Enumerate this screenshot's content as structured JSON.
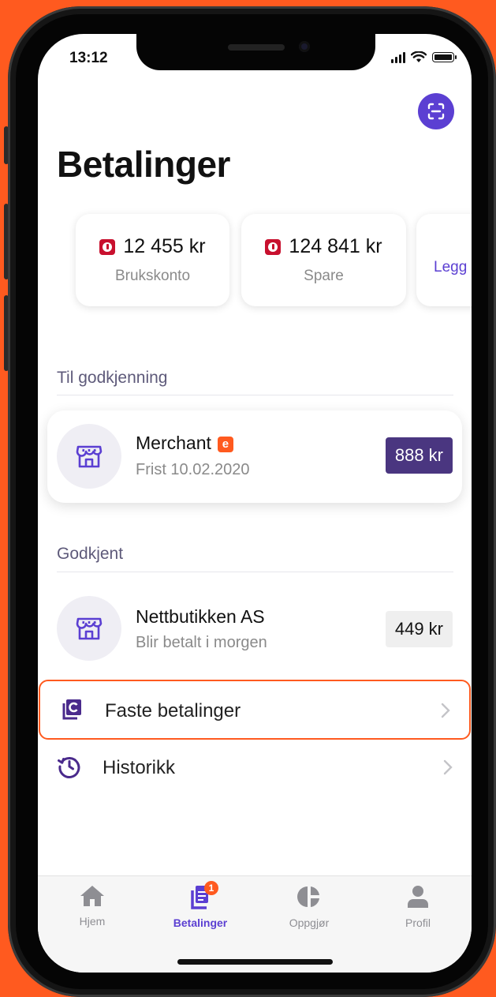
{
  "status_bar": {
    "time": "13:12"
  },
  "header": {
    "title": "Betalinger",
    "scan_icon": "qr-scan-icon"
  },
  "accounts": [
    {
      "amount": "12 455 kr",
      "label": "Brukskonto",
      "icon": "bank-badge-icon"
    },
    {
      "amount": "124 841 kr",
      "label": "Spare",
      "icon": "bank-badge-icon"
    },
    {
      "label": "Legg"
    }
  ],
  "sections": {
    "pending": {
      "label": "Til godkjenning",
      "item": {
        "title": "Merchant",
        "badge": "e",
        "subtitle": "Frist 10.02.2020",
        "amount": "888 kr"
      }
    },
    "approved": {
      "label": "Godkjent",
      "item": {
        "title": "Nettbutikken AS",
        "subtitle": "Blir betalt i morgen",
        "amount": "449 kr"
      }
    }
  },
  "menu": [
    {
      "label": "Faste betalinger",
      "icon": "recurring-payments-icon"
    },
    {
      "label": "Historikk",
      "icon": "history-icon"
    }
  ],
  "tabbar": {
    "tabs": [
      {
        "label": "Hjem",
        "icon": "home-icon"
      },
      {
        "label": "Betalinger",
        "icon": "payments-icon",
        "badge": "1",
        "active": true
      },
      {
        "label": "Oppgjør",
        "icon": "pie-chart-icon"
      },
      {
        "label": "Profil",
        "icon": "person-icon"
      }
    ]
  },
  "colors": {
    "accent": "#5b3fd2",
    "brand_orange": "#ff5a1f",
    "pending_amount_bg": "#4a3680",
    "approved_amount_bg": "#efefef"
  }
}
